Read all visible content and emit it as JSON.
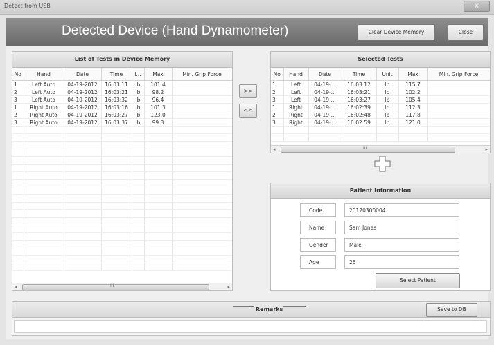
{
  "window": {
    "title": "Detect from USB",
    "close_glyph": "x"
  },
  "header": {
    "title": "Detected Device (Hand Dynamometer)",
    "clear_label": "Clear Device Memory",
    "close_label": "Close"
  },
  "memory": {
    "title": "List of Tests in Device Memory",
    "columns": [
      "No",
      "Hand",
      "Date",
      "Time",
      "I...",
      "Max",
      "Min. Grip Force"
    ],
    "rows": [
      [
        "1",
        "Left Auto",
        "04-19-2012",
        "16:03:11",
        "lb",
        "101.4",
        ""
      ],
      [
        "2",
        "Left Auto",
        "04-19-2012",
        "16:03:21",
        "lb",
        "98.2",
        ""
      ],
      [
        "3",
        "Left Auto",
        "04-19-2012",
        "16:03:32",
        "lb",
        "96.4",
        ""
      ],
      [
        "1",
        "Right Auto",
        "04-19-2012",
        "16:03:16",
        "lb",
        "101.3",
        ""
      ],
      [
        "2",
        "Right Auto",
        "04-19-2012",
        "16:03:27",
        "lb",
        "123.0",
        ""
      ],
      [
        "3",
        "Right Auto",
        "04-19-2012",
        "16:03:37",
        "lb",
        "99.3",
        ""
      ]
    ],
    "scroll_center": "III"
  },
  "transfer": {
    "add_label": ">>",
    "remove_label": "<<"
  },
  "selected": {
    "title": "Selected Tests",
    "columns": [
      "No",
      "Hand",
      "Date",
      "Time",
      "Unit",
      "Max",
      "Min. Grip Force"
    ],
    "rows": [
      [
        "1",
        "Left",
        "04-19-...",
        "16:03:12",
        "lb",
        "115.7",
        ""
      ],
      [
        "2",
        "Left",
        "04-19-...",
        "16:03:21",
        "lb",
        "102.2",
        ""
      ],
      [
        "3",
        "Left",
        "04-19-...",
        "16:03:27",
        "lb",
        "105.4",
        ""
      ],
      [
        "1",
        "Right",
        "04-19-...",
        "16:02:39",
        "lb",
        "112.3",
        ""
      ],
      [
        "2",
        "Right",
        "04-19-...",
        "16:02:48",
        "lb",
        "117.8",
        ""
      ],
      [
        "3",
        "Right",
        "04-19-...",
        "16:02:59",
        "lb",
        "121.0",
        ""
      ]
    ],
    "scroll_center": "III"
  },
  "patient": {
    "title": "Patient Information",
    "code_label": "Code",
    "code_value": "20120300004",
    "name_label": "Name",
    "name_value": "Sam Jones",
    "gender_label": "Gender",
    "gender_value": "Male",
    "age_label": "Age",
    "age_value": "25",
    "select_label": "Select Patient"
  },
  "remarks": {
    "title": "Remarks",
    "save_label": "Save to DB",
    "text": ""
  },
  "icons": {
    "move": "move-cross-icon"
  }
}
